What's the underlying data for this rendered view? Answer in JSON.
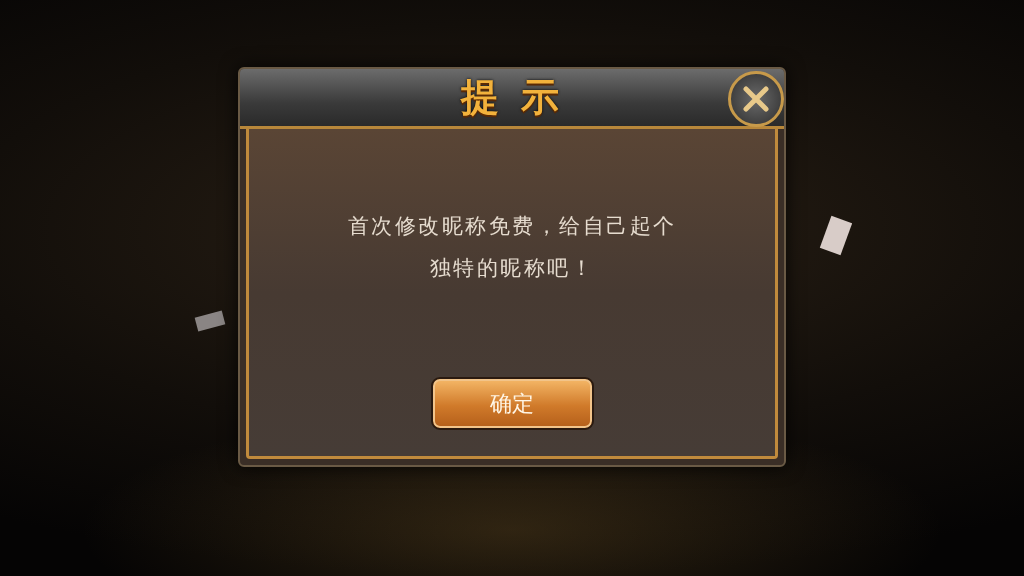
{
  "dialog": {
    "title": "提 示",
    "message": "首次修改昵称免费，给自己起个独特的昵称吧！",
    "button": "确定"
  }
}
